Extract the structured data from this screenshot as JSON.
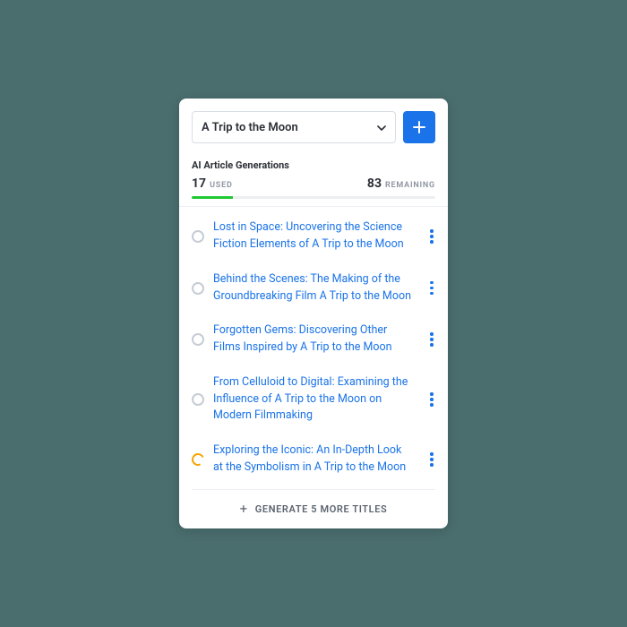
{
  "header": {
    "selected": "A Trip to the Moon"
  },
  "usage": {
    "title": "AI Article Generations",
    "used_value": "17",
    "used_label": "Used",
    "remaining_value": "83",
    "remaining_label": "Remaining",
    "percent_used": 17
  },
  "items": [
    {
      "title": "Lost in Space: Uncovering the Science Fiction Elements of A Trip to the Moon",
      "state": "idle"
    },
    {
      "title": "Behind the Scenes: The Making of the Groundbreaking Film A Trip to the Moon",
      "state": "idle"
    },
    {
      "title": "Forgotten Gems: Discovering Other Films Inspired by A Trip to the Moon",
      "state": "idle"
    },
    {
      "title": "From Celluloid to Digital: Examining the Influence of A Trip to the Moon on Modern Filmmaking",
      "state": "idle"
    },
    {
      "title": "Exploring the Iconic: An In-Depth Look at the Symbolism in A Trip to the Moon",
      "state": "loading"
    }
  ],
  "footer": {
    "label": "GENERATE 5 MORE TITLES"
  }
}
